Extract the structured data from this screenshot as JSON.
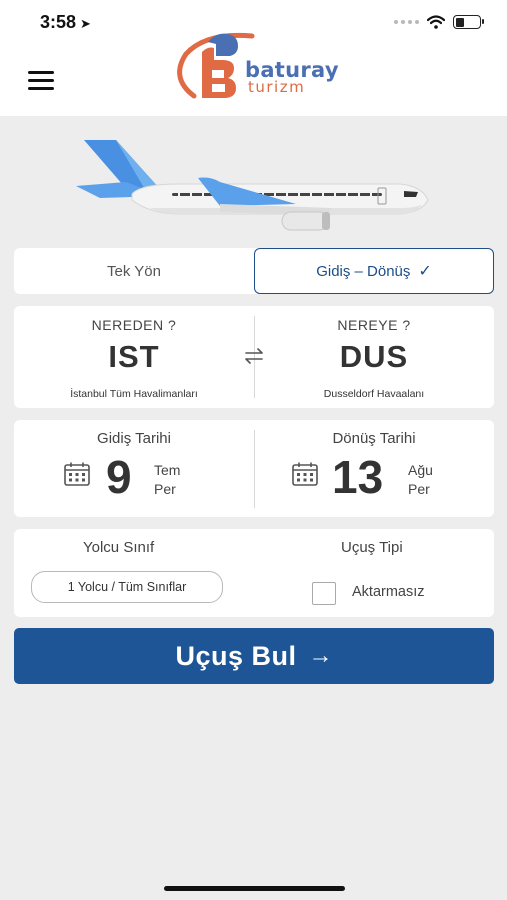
{
  "status_bar": {
    "time": "3:58",
    "location_arrow": "➤"
  },
  "header": {
    "menu_icon": "hamburger-icon",
    "logo": {
      "line1": "baturay",
      "line2": "turizm",
      "brand_blue": "#4b6fb3",
      "brand_orange": "#df6a43"
    }
  },
  "trip_type": {
    "one_way": "Tek Yön",
    "round_trip": "Gidiş – Dönüş",
    "selected": "round_trip",
    "check_glyph": "✓"
  },
  "route": {
    "from_label": "NEREDEN ?",
    "from_code": "IST",
    "from_name": "İstanbul Tüm Havalimanları",
    "to_label": "NEREYE ?",
    "to_code": "DUS",
    "to_name": "Dusseldorf Havaalanı",
    "swap_icon": "swap-arrows-icon"
  },
  "dates": {
    "departure_label": "Gidiş Tarihi",
    "departure_day": "9",
    "departure_month": "Tem",
    "departure_weekday": "Per",
    "return_label": "Dönüş Tarihi",
    "return_day": "13",
    "return_month": "Ağu",
    "return_weekday": "Per"
  },
  "passengers": {
    "class_label": "Yolcu Sınıf",
    "class_value": "1 Yolcu / Tüm Sınıflar",
    "flight_type_label": "Uçuş Tipi",
    "nonstop_label": "Aktarmasız",
    "nonstop_checked": false
  },
  "search_button": {
    "label": "Uçuş Bul",
    "arrow": "→",
    "color": "#1d5597"
  }
}
